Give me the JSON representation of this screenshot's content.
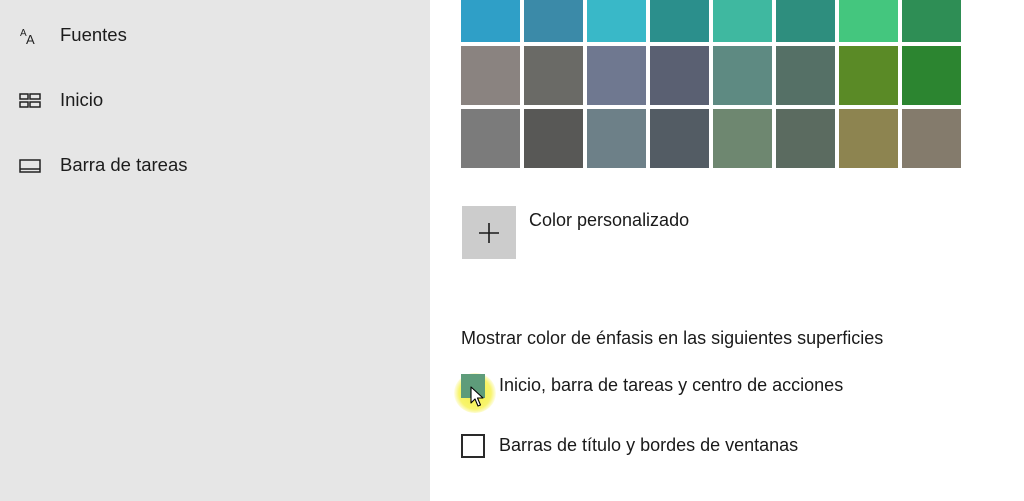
{
  "sidebar": {
    "items": [
      {
        "label": "Fuentes",
        "icon": "fonts-icon"
      },
      {
        "label": "Inicio",
        "icon": "start-icon"
      },
      {
        "label": "Barra de tareas",
        "icon": "taskbar-icon"
      }
    ]
  },
  "colors": {
    "rows": [
      [
        "#2f9fc7",
        "#3b8aa8",
        "#39b8c8",
        "#2b8f8c",
        "#3fb8a0",
        "#2e8e7e",
        "#44c67e",
        "#2e8e55"
      ],
      [
        "#8a8380",
        "#6a6a66",
        "#6f7890",
        "#5a6072",
        "#5e8a82",
        "#557066",
        "#5a8a26",
        "#2c8530"
      ],
      [
        "#7b7b7b",
        "#585856",
        "#6d8088",
        "#535c64",
        "#6e8770",
        "#5b6b60",
        "#8d8450",
        "#847b6c"
      ]
    ]
  },
  "custom_color": {
    "label": "Color personalizado",
    "icon": "plus-icon"
  },
  "accent": {
    "heading": "Mostrar color de énfasis en las siguientes superficies",
    "option1": {
      "label": "Inicio, barra de tareas y centro de acciones",
      "checked": true
    },
    "option2": {
      "label": "Barras de título y bordes de ventanas",
      "checked": false
    }
  }
}
